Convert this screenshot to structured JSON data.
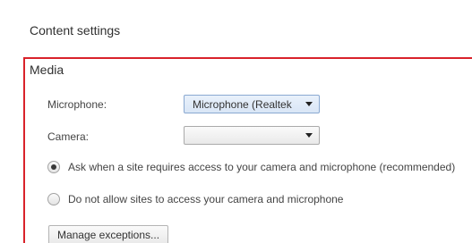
{
  "page": {
    "title": "Content settings"
  },
  "media": {
    "title": "Media",
    "microphone": {
      "label": "Microphone:",
      "value": "Microphone (Realtek"
    },
    "camera": {
      "label": "Camera:",
      "value": ""
    },
    "options": [
      {
        "label": "Ask when a site requires access to your camera and microphone (recommended)",
        "checked": true
      },
      {
        "label": "Do not allow sites to access your camera and microphone",
        "checked": false
      }
    ],
    "manage_button": "Manage exceptions...",
    "highlight_color": "#d9222a"
  }
}
